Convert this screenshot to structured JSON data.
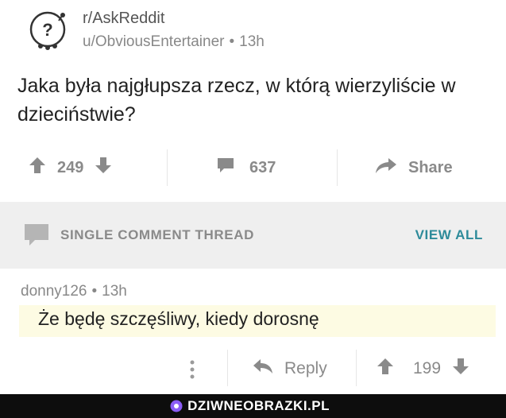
{
  "post": {
    "subreddit": "r/AskReddit",
    "author": "u/ObviousEntertainer",
    "age": "13h",
    "title": "Jaka była najgłupsza rzecz, w którą wierzyliście w dzieciństwie?"
  },
  "actions": {
    "score": "249",
    "comments": "637",
    "share_label": "Share"
  },
  "thread": {
    "label": "SINGLE COMMENT THREAD",
    "view_all_label": "VIEW ALL"
  },
  "comment": {
    "author": "donny126",
    "age": "13h",
    "text": "Że będę szczęśliwy, kiedy dorosnę",
    "reply_label": "Reply",
    "score": "199"
  },
  "footer": {
    "brand": "DZIWNEOBRAZKI.PL"
  },
  "colors": {
    "accent": "#2e8b9a",
    "muted": "#8a8a8a",
    "thread_bg": "#efefef",
    "highlight_bg": "#fdfbe3",
    "footer_bg": "#0d0d0d"
  },
  "icons": [
    "subreddit-avatar-icon",
    "upvote-icon",
    "downvote-icon",
    "comment-icon",
    "share-icon",
    "thread-comment-icon",
    "more-dots-icon",
    "reply-icon",
    "brand-logo-icon"
  ]
}
